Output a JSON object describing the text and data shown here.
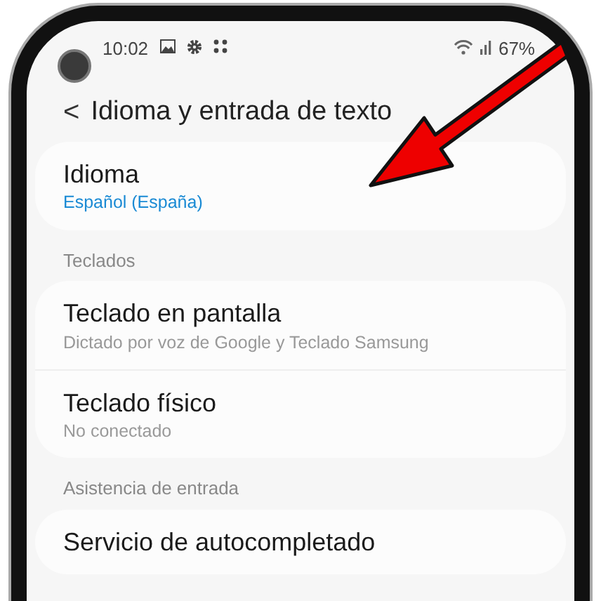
{
  "status_bar": {
    "time": "10:02",
    "battery": "67%"
  },
  "header": {
    "back": "<",
    "title": "Idioma y entrada de texto"
  },
  "groups": [
    {
      "items": [
        {
          "title": "Idioma",
          "subtitle": "Español (España)",
          "kind": "value"
        }
      ]
    },
    {
      "label": "Teclados",
      "items": [
        {
          "title": "Teclado en pantalla",
          "subtitle": "Dictado por voz de Google y Teclado Samsung",
          "kind": "summary"
        },
        {
          "title": "Teclado físico",
          "subtitle": "No conectado",
          "kind": "summary"
        }
      ]
    },
    {
      "label": "Asistencia de entrada",
      "items": [
        {
          "title": "Servicio de autocompletado",
          "kind": "plain"
        }
      ]
    }
  ]
}
